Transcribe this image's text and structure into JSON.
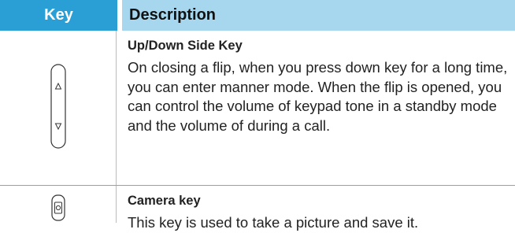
{
  "header": {
    "key": "Key",
    "description": "Description"
  },
  "rows": [
    {
      "icon": "up-down-side-key-icon",
      "title": "Up/Down Side Key",
      "text": "On closing a flip, when you press down key for a long time, you can enter manner mode. When the flip is opened, you can control the volume of keypad tone in a standby mode and the volume of during a call."
    },
    {
      "icon": "camera-key-icon",
      "title": "Camera key",
      "text": "This key is used to take a picture and save it."
    }
  ],
  "colors": {
    "header_key_bg": "#2a9fd6",
    "header_desc_bg": "#a7d7ef",
    "divider": "#5bb3e0"
  }
}
